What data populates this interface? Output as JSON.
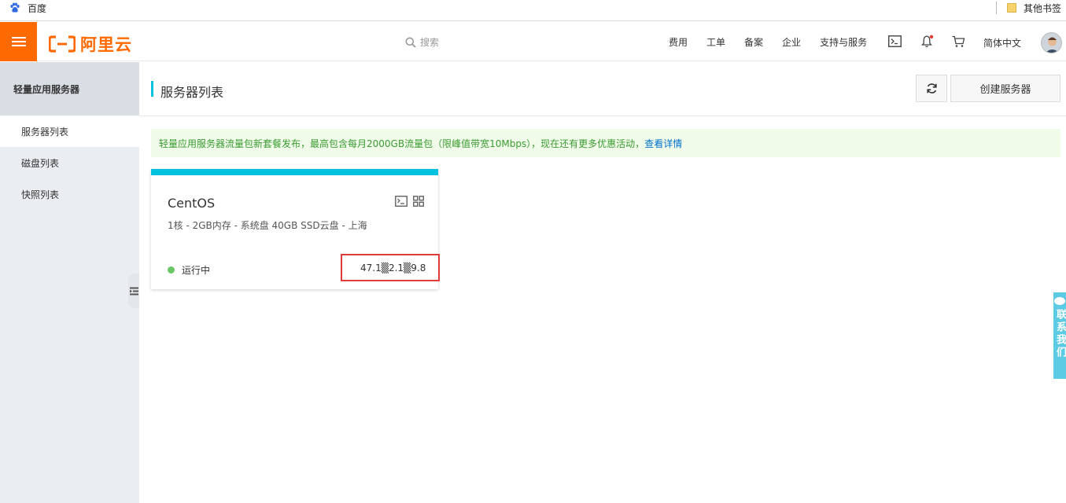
{
  "bookmarks": {
    "baidu_label": "百度",
    "other_label": "其他书签"
  },
  "topnav": {
    "logo_text": "阿里云",
    "search_placeholder": "搜索",
    "links": [
      "费用",
      "工单",
      "备案",
      "企业",
      "支持与服务"
    ],
    "language": "简体中文",
    "icons": [
      "terminal-icon",
      "bell-icon",
      "cart-icon"
    ],
    "accent_color": "#ff6a00"
  },
  "sidebar": {
    "title": "轻量应用服务器",
    "items": [
      {
        "label": "服务器列表",
        "active": true
      },
      {
        "label": "磁盘列表",
        "active": false
      },
      {
        "label": "快照列表",
        "active": false
      }
    ]
  },
  "main": {
    "page_title": "服务器列表",
    "create_label": "创建服务器",
    "notice_text": "轻量应用服务器流量包新套餐发布，最高包含每月2000GB流量包（限峰值带宽10Mbps），现在还有更多优惠活动，",
    "notice_link": "查看详情"
  },
  "server_card": {
    "os": "CentOS",
    "spec": "1核 - 2GB内存 - 系统盘 40GB SSD云盘 - 上海",
    "status": "运行中",
    "ip": "47.1▒2.1▒9.8",
    "status_color": "#68c868",
    "accent_color": "#00c1de"
  },
  "contact": {
    "label": "联系我们"
  }
}
